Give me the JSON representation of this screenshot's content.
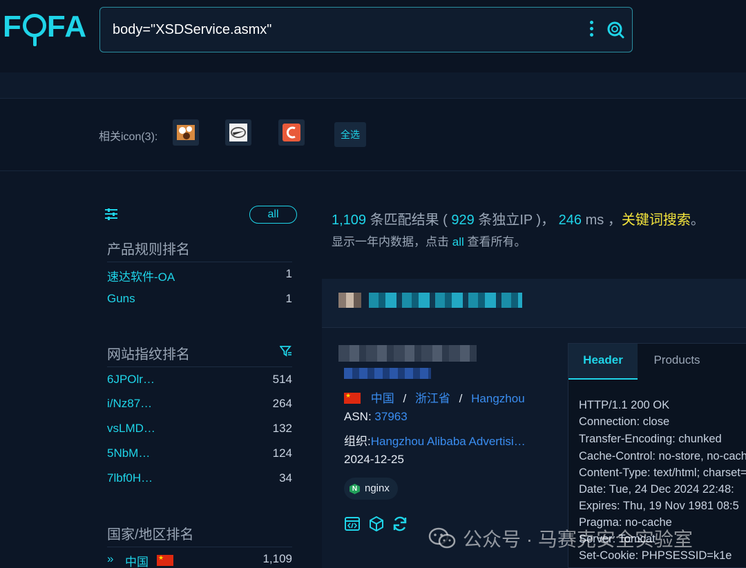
{
  "brand": {
    "logo_text": "FOFA"
  },
  "search": {
    "query": "body=\"XSDService.asmx\""
  },
  "related_icons": {
    "label": "相关icon(3):",
    "select_all": "全选"
  },
  "sidebar": {
    "all_label": "all",
    "product_rank": {
      "title": "产品规则排名",
      "items": [
        {
          "name": "速达软件-OA",
          "count": "1"
        },
        {
          "name": "Guns",
          "count": "1"
        }
      ]
    },
    "fingerprint_rank": {
      "title": "网站指纹排名",
      "items": [
        {
          "name": "6JPOlr…",
          "count": "514"
        },
        {
          "name": "i/Nz87…",
          "count": "264"
        },
        {
          "name": "vsLMD…",
          "count": "132"
        },
        {
          "name": "5NbM…",
          "count": "124"
        },
        {
          "name": "7lbf0H…",
          "count": "34"
        }
      ]
    },
    "country_rank": {
      "title": "国家/地区排名",
      "items": [
        {
          "name": "中国",
          "count": "1,109"
        }
      ]
    }
  },
  "summary": {
    "count": "1,109",
    "text_matches": "条匹配结果 (",
    "unique_ip": "929",
    "text_unique": "条独立IP )，",
    "ms": "246",
    "text_ms": "ms ，",
    "keyword": "关键词搜索",
    "text_end": "。",
    "sub_before": "显示一年内数据，点击",
    "sub_link": "all",
    "sub_after": "查看所有。"
  },
  "result": {
    "country": "中国",
    "province": "浙江省",
    "city": "Hangzhou",
    "asn_label": "ASN:",
    "asn": "37963",
    "org_label": "组织:",
    "org": "Hangzhou Alibaba Advertisi…",
    "date": "2024-12-25",
    "tech": "nginx",
    "tabs": {
      "header": "Header",
      "products": "Products"
    },
    "header_lines": [
      "HTTP/1.1 200 OK",
      "Connection: close",
      "Transfer-Encoding: chunked",
      "Cache-Control: no-store, no-cache",
      "Content-Type: text/html; charset=",
      "Date: Tue, 24 Dec 2024 22:48:",
      "Expires: Thu, 19 Nov 1981 08:5",
      "Pragma: no-cache",
      "Server: Tomcat",
      "Set-Cookie: PHPSESSID=k1e"
    ]
  },
  "watermark": {
    "text": "公众号 · 马赛克安全实验室"
  },
  "colors": {
    "accent": "#1fd4e8",
    "keyword": "#f2e33c",
    "link": "#3a8df0",
    "background": "#0c1626"
  }
}
